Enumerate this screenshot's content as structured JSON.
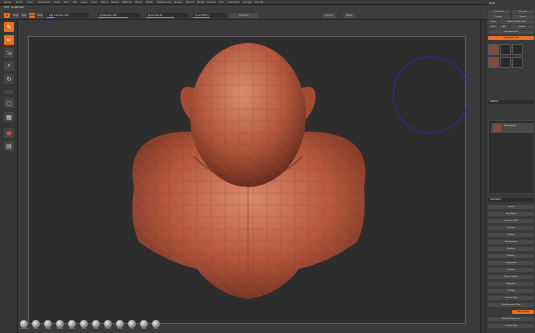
{
  "menu": {
    "items": [
      "Alpha",
      "Brush",
      "Color",
      "Document",
      "Draw",
      "Edit",
      "File",
      "Layer",
      "Light",
      "Macro",
      "Marker",
      "Material",
      "Movie",
      "Picker",
      "Preferences",
      "Render",
      "Stencil",
      "Stroke",
      "Texture",
      "Tool",
      "Transform",
      "Zplugin",
      "Zscript"
    ]
  },
  "toolbar": {
    "doc_title": "Tool: undefined",
    "mrgb": "Mrgb",
    "rgb": "Rgb",
    "m": "M",
    "zadd": "Zadd",
    "zsub": "Zsub",
    "zcut": "Zcut",
    "rgb_intensity": "Rgb Intensity 100",
    "z_intensity": "Z Intensity 100",
    "draw_size": "Draw Size 64",
    "focal_shift": "Focal Shift 0",
    "dynamic": "Dynamic",
    "double": "Double",
    "persp": "Persp"
  },
  "left_shelf": {
    "items": [
      {
        "icon": "edit-icon",
        "state": "active"
      },
      {
        "icon": "draw-icon",
        "state": "active"
      },
      {
        "icon": "move-icon",
        "state": "normal"
      },
      {
        "icon": "scale-icon",
        "state": "normal"
      },
      {
        "icon": "rotate-icon",
        "state": "normal"
      },
      {
        "icon": "brush-icon",
        "state": "normal"
      },
      {
        "icon": "frame-icon",
        "state": "normal"
      },
      {
        "icon": "polyframe-icon",
        "state": "normal"
      },
      {
        "icon": "material-sphere-icon",
        "state": "red"
      },
      {
        "icon": "gradient-icon",
        "state": "normal"
      }
    ]
  },
  "brushes": [
    "Standard",
    "Move",
    "ClayB",
    "DamSt",
    "hPolish",
    "Pinch",
    "Inflat",
    "TrimD",
    "Planar",
    "Clip",
    "Mask",
    "Slash",
    "Snake",
    "MAHcut",
    "Curve"
  ],
  "tray": {
    "title": "Tool",
    "load_tool": "Load Tool",
    "save_as": "Save As",
    "import": "Import",
    "export": "Export",
    "clone": "Clone",
    "make_polymesh": "Make PolyMesh3D",
    "goz": "GoZ",
    "all": "All",
    "visible": "Visible",
    "lightbox_tools": "Lightbox▸Tools",
    "tool_name": "Dwarf_bust. 48",
    "subtool_section": "SubTool",
    "subtool_item": "Dwarf_bust",
    "geometry": "Geometry",
    "layers": "Layers",
    "fibermesh": "FiberMesh",
    "geometry_hd": "Geometry HD",
    "preview": "Preview",
    "surface": "Surface",
    "deformation": "Deformation",
    "masking": "Masking",
    "visibility": "Visibility",
    "polygroups": "Polygroups",
    "contact": "Contact",
    "morph_target": "Morph Target",
    "polypaint": "Polypaint",
    "uv_map": "UV Map",
    "texture_map": "Texture Map",
    "displacement": "Displacement Map",
    "normal_map": "Normal Map",
    "vector_disp": "Vector Displacement Map",
    "display_props": "Display Properties",
    "unified_skin": "Unified Skin",
    "initialize": "Initialize",
    "import2": "Import",
    "export2": "Export"
  }
}
